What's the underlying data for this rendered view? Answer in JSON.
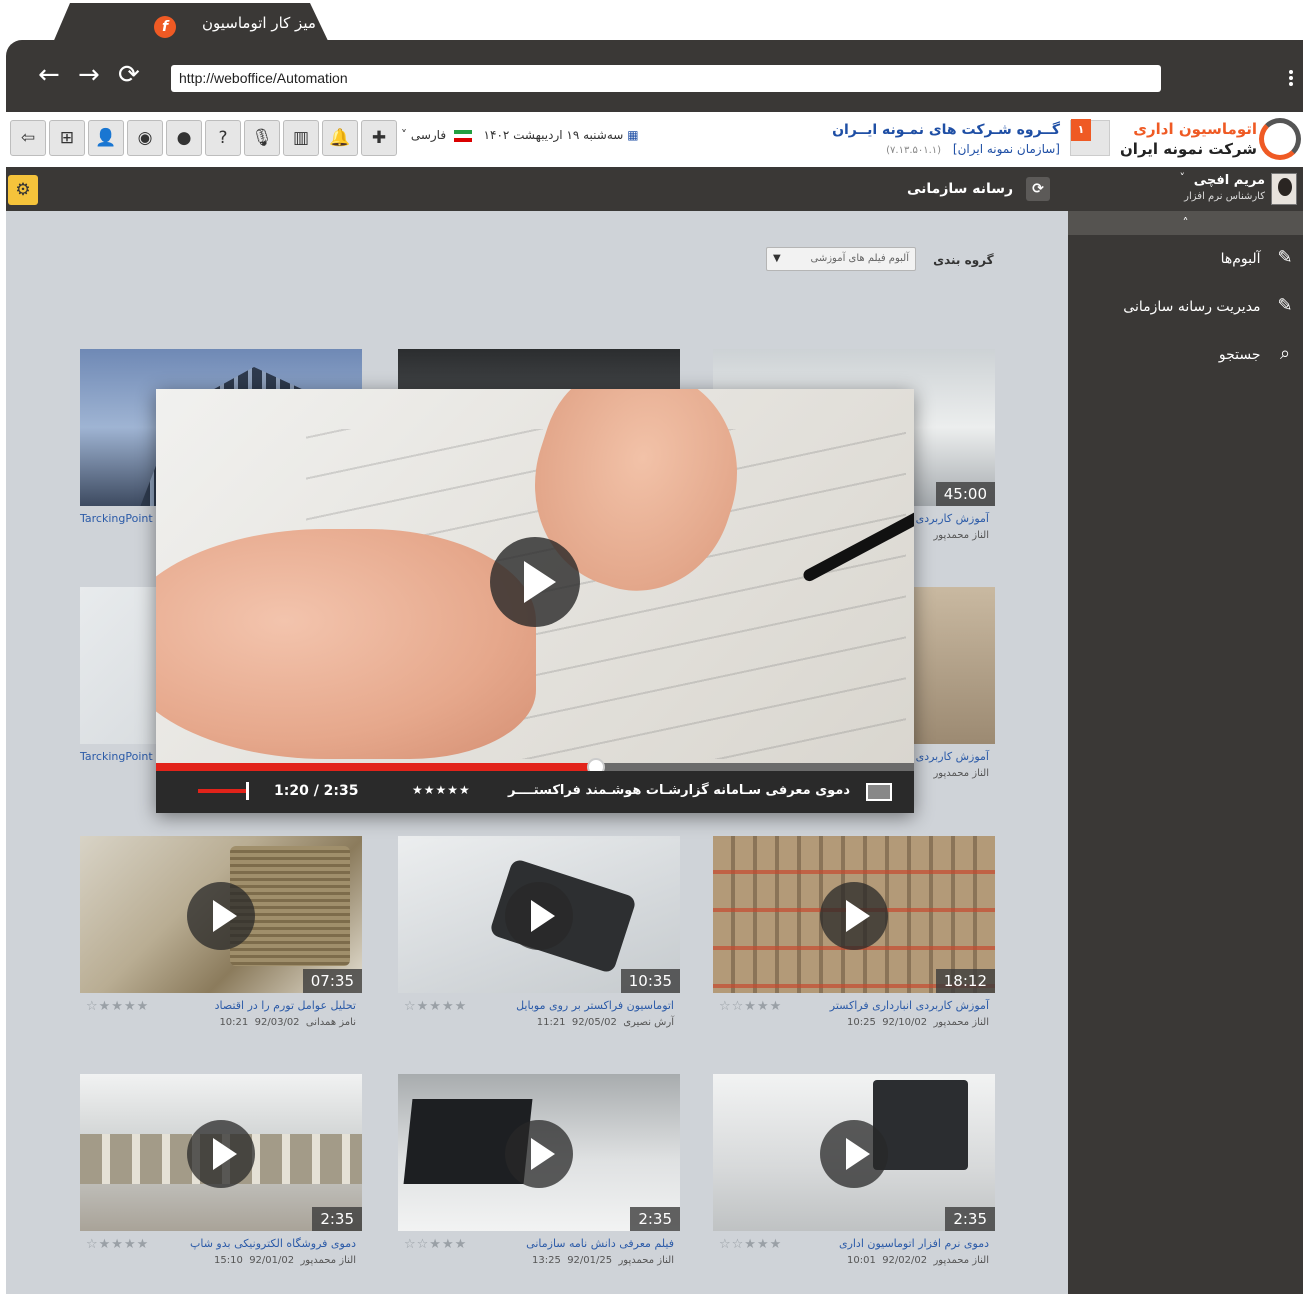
{
  "browser": {
    "tab_title": "میز کار اتوماسیون",
    "url": "http://weboffice/Automation",
    "back_glyph": "←",
    "forward_glyph": "→",
    "reload_glyph": "⟳"
  },
  "brand": {
    "line1": "اتوماسیون اداری",
    "line2": "شرکت نمونه ایران",
    "accent_color": "#ef5a24"
  },
  "company": {
    "badge_count": "۱",
    "name": "گــروه شـرکت های نمـونه ایــران",
    "org": "[سازمان نمونه ایران]",
    "version": "(۷.۱۳.۵۰۱.۱)"
  },
  "header": {
    "date": "سه‌شنبه ۱۹ اردیبهشت ۱۴۰۲",
    "language": "فارسی",
    "language_caret": "˅",
    "tools": [
      {
        "icon": "puzzle-icon",
        "glyph": "✚"
      },
      {
        "icon": "bell-icon",
        "glyph": "🔔"
      },
      {
        "icon": "chart-icon",
        "glyph": "▥"
      },
      {
        "icon": "microphone-icon",
        "glyph": "🎙"
      },
      {
        "icon": "help-icon",
        "glyph": "?"
      },
      {
        "icon": "chat-icon",
        "glyph": "●"
      },
      {
        "icon": "chats-icon",
        "glyph": "◉"
      },
      {
        "icon": "user-icon",
        "glyph": "👤"
      },
      {
        "icon": "org-chart-icon",
        "glyph": "⊞"
      },
      {
        "icon": "logout-icon",
        "glyph": "⇦"
      }
    ]
  },
  "content": {
    "section_title": "رسانه سازمانی",
    "refresh_glyph": "⟳",
    "settings_glyph": "⚙",
    "group_label": "گروه بندی",
    "group_value": "آلبوم فیلم های آموزشی"
  },
  "cards": [
    {
      "title": "آموزش کاربردی انبارداری فراکستر",
      "author": "الناز محمدپور",
      "date": "92/10/02",
      "time": "10:25",
      "duration": "18:12",
      "stars": "☆☆★★★"
    },
    {
      "title": "اتوماسیون فراکستر بر روی موبایل",
      "author": "آرش نصیری",
      "date": "92/05/02",
      "time": "11:21",
      "duration": "10:35",
      "stars": "☆★★★★"
    },
    {
      "title": "تحلیل عوامل تورم را در اقتصاد",
      "author": "نامز همدانی",
      "date": "92/03/02",
      "time": "10:21",
      "duration": "07:35",
      "stars": "☆★★★★"
    },
    {
      "title": "دموی نرم افزار اتوماسیون اداری",
      "author": "الناز محمدپور",
      "date": "92/02/02",
      "time": "10:01",
      "duration": "2:35",
      "stars": "☆☆★★★"
    },
    {
      "title": "فیلم معرفی دانش نامه سازمانی",
      "author": "الناز محمدپور",
      "date": "92/01/25",
      "time": "13:25",
      "duration": "2:35",
      "stars": "☆☆★★★"
    },
    {
      "title": "دموی فروشگاه الکترونیکی بدو شاپ",
      "author": "الناز محمدپور",
      "date": "92/01/02",
      "time": "15:10",
      "duration": "2:35",
      "stars": "☆★★★★"
    }
  ],
  "bg_cards": [
    {
      "title": "آموزش کاربردی",
      "author": "الناز محمدپور",
      "duration": "45:00"
    },
    {
      "title": "آموزش کاربردی",
      "author": "الناز محمدپور"
    },
    {
      "title": "TarckingPoint"
    },
    {
      "title": "TarckingPoint"
    }
  ],
  "player": {
    "title": "دموی معرفی سـامانه گزارشـات هوشـمند فراکستــــر",
    "time": "1:20 / 2:35",
    "progress": 0.58,
    "volume": 0.7,
    "stars": "★★★★★"
  },
  "sidebar": {
    "user_name": "مریم افچی",
    "user_role": "کارشناس نرم افزار",
    "user_caret": "˅",
    "collapse_glyph": "˄",
    "items": [
      {
        "label": "آلبوم‌ها",
        "icon": "edit-icon",
        "glyph": "✎"
      },
      {
        "label": "مدیریت رسانه سازمانی",
        "icon": "edit-icon",
        "glyph": "✎"
      },
      {
        "label": "جستجو",
        "icon": "search-icon",
        "glyph": "⌕"
      }
    ]
  }
}
